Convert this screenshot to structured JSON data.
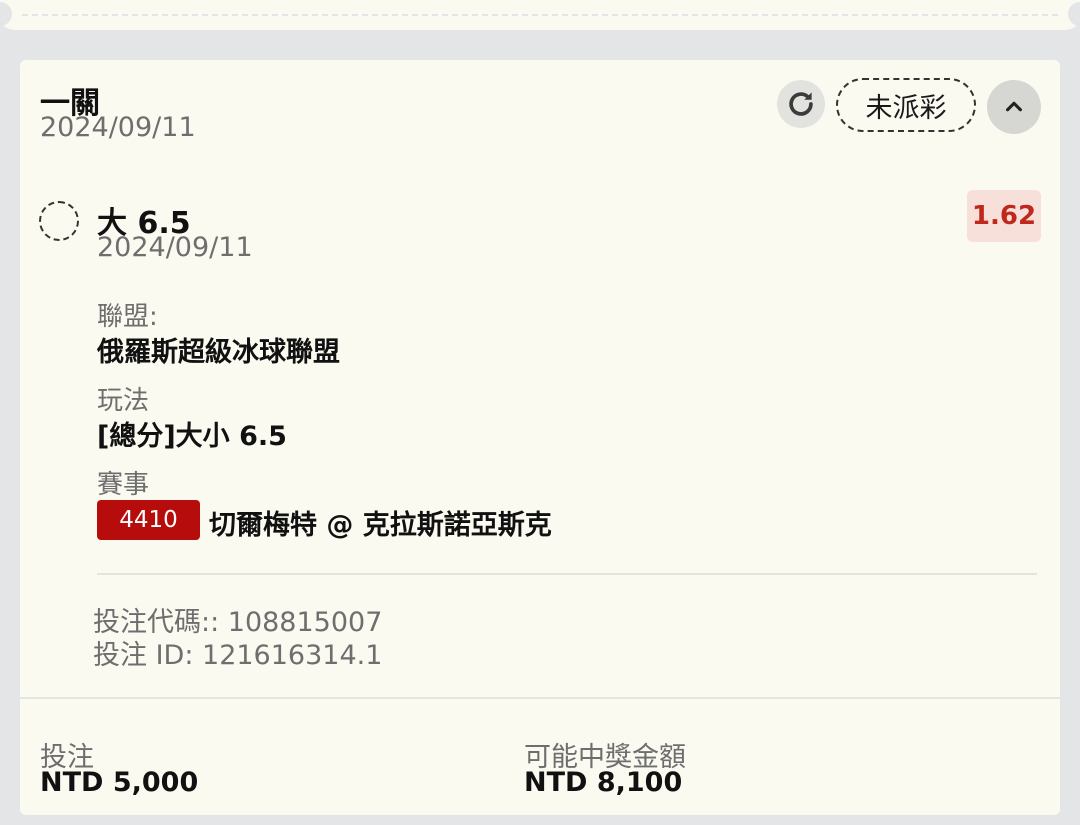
{
  "bet": {
    "type": "一關",
    "date": "2024/09/11",
    "status": "未派彩"
  },
  "selection": {
    "name": "大 6.5",
    "date": "2024/09/11",
    "odds": "1.62",
    "league_label": "聯盟:",
    "league": "俄羅斯超級冰球聯盟",
    "market_label": "玩法",
    "market": "[總分]大小 6.5",
    "event_label": "賽事",
    "event_id": "4410",
    "event_name": "切爾梅特 @ 克拉斯諾亞斯克"
  },
  "codes": {
    "bet_code": "投注代碼:: 108815007",
    "bet_id": "投注 ID: 121616314.1"
  },
  "summary": {
    "stake_label": "投注",
    "stake_value": "NTD 5,000",
    "payout_label": "可能中獎金額",
    "payout_value": "NTD 8,100"
  },
  "icons": {
    "refresh": "refresh-icon",
    "collapse": "chevron-up-icon",
    "result": "pending-result-icon"
  },
  "colors": {
    "event_badge": "#b70c0c",
    "odds_text": "#c0281c",
    "odds_bg": "#f6e0d9",
    "card_bg": "#fbfaf1"
  }
}
